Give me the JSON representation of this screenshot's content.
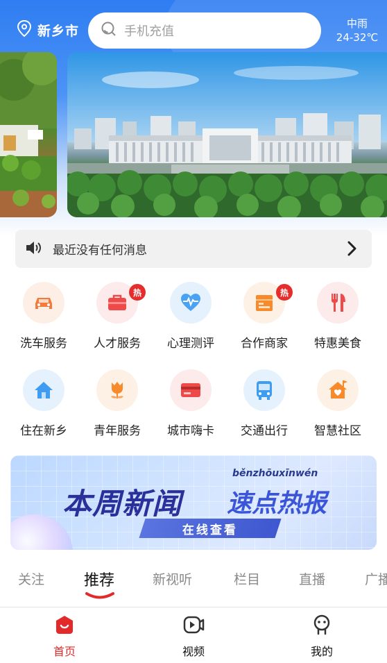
{
  "header": {
    "location": "新乡市",
    "search_placeholder": "手机充值",
    "weather": {
      "condition": "中雨",
      "temperature": "24-32℃"
    }
  },
  "notice": {
    "text": "最近没有任何消息"
  },
  "services": [
    {
      "label": "洗车服务",
      "icon": "car-icon",
      "color": "#f37a3c",
      "bg": "#fdeee6",
      "hot": ""
    },
    {
      "label": "人才服务",
      "icon": "briefcase-icon",
      "color": "#ef4a4a",
      "bg": "#fdeaea",
      "hot": "热"
    },
    {
      "label": "心理测评",
      "icon": "heart-pulse-icon",
      "color": "#3f9cf0",
      "bg": "#e5f2fd",
      "hot": ""
    },
    {
      "label": "合作商家",
      "icon": "store-icon",
      "color": "#f78a2a",
      "bg": "#fdf0e5",
      "hot": "热"
    },
    {
      "label": "特惠美食",
      "icon": "fork-knife-icon",
      "color": "#ef4a4a",
      "bg": "#fdeaea",
      "hot": ""
    },
    {
      "label": "住在新乡",
      "icon": "home-icon",
      "color": "#3f9cf0",
      "bg": "#e5f2fd",
      "hot": ""
    },
    {
      "label": "青年服务",
      "icon": "tulip-icon",
      "color": "#f78a2a",
      "bg": "#fdf0e5",
      "hot": ""
    },
    {
      "label": "城市嗨卡",
      "icon": "card-icon",
      "color": "#ef4a4a",
      "bg": "#fdeaea",
      "hot": ""
    },
    {
      "label": "交通出行",
      "icon": "bus-icon",
      "color": "#3f9cf0",
      "bg": "#e5f2fd",
      "hot": ""
    },
    {
      "label": "智慧社区",
      "icon": "community-icon",
      "color": "#f78a2a",
      "bg": "#fdf0e5",
      "hot": ""
    }
  ],
  "news_banner": {
    "pinyin": "běnzhōuxīnwén",
    "title_main": "本周新闻",
    "title_sub": "速点热报",
    "button_label": "在线查看"
  },
  "tabs": [
    "关注",
    "推荐",
    "新视听",
    "栏目",
    "直播",
    "广播"
  ],
  "active_tab": "推荐",
  "bottom_nav": [
    {
      "label": "首页",
      "icon": "home-nav-icon",
      "active": true
    },
    {
      "label": "视频",
      "icon": "video-icon",
      "active": false
    },
    {
      "label": "我的",
      "icon": "profile-icon",
      "active": false
    }
  ],
  "colors": {
    "primary_blue": "#2f7df2",
    "accent_red": "#e22a2a"
  }
}
